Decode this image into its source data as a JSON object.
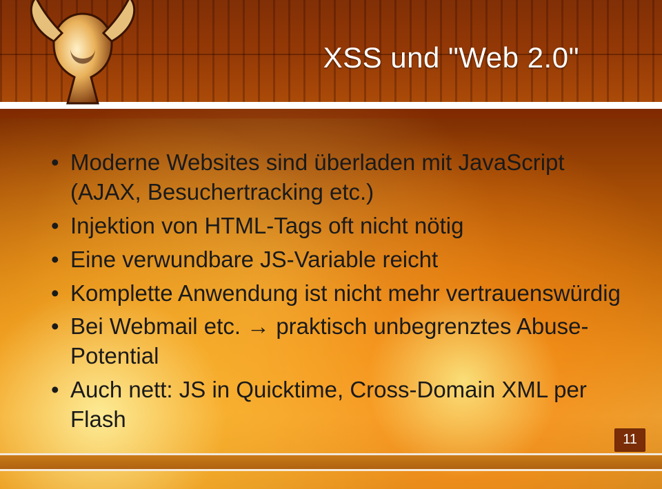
{
  "title": "XSS und \"Web 2.0\"",
  "bullets": [
    "Moderne Websites sind überladen mit JavaScript (AJAX, Besuchertracking etc.)",
    "Injektion von HTML-Tags oft nicht nötig",
    "Eine verwundbare JS-Variable reicht",
    "Komplette Anwendung ist nicht mehr vertrauenswürdig",
    "Bei Webmail etc. → praktisch unbegrenztes Abuse-Potential",
    "Auch nett: JS in Quicktime, Cross-Domain XML per Flash"
  ],
  "page_number": "11"
}
